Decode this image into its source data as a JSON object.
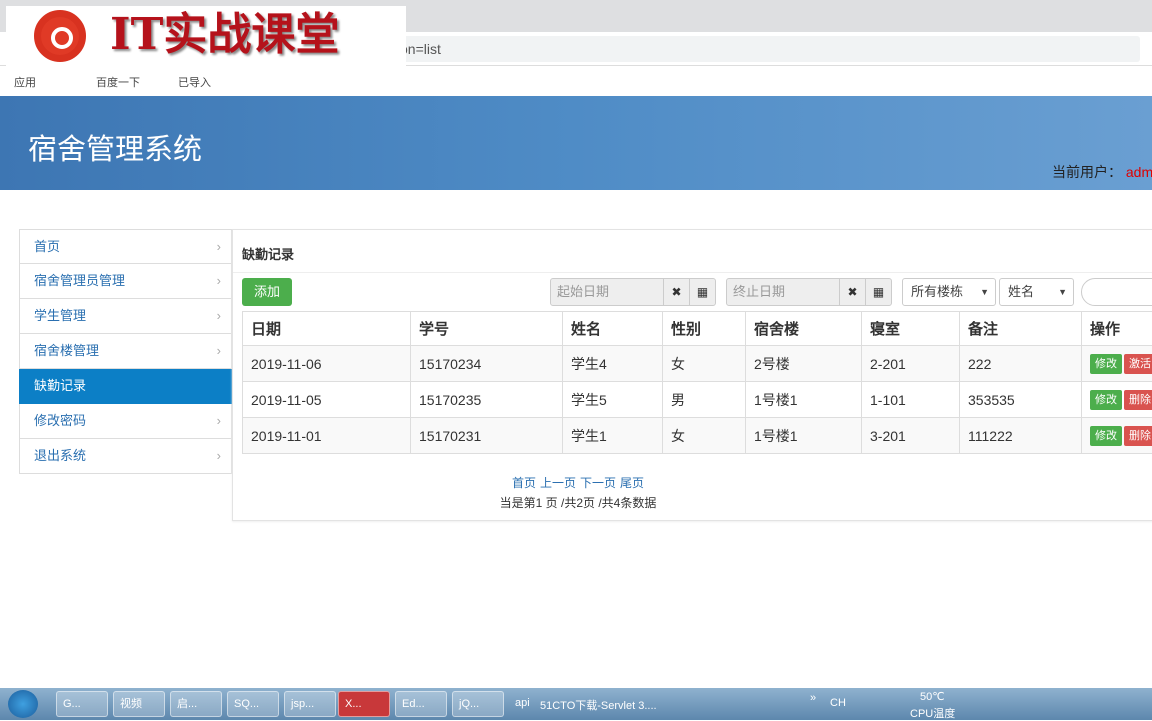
{
  "browser": {
    "address": "on=list",
    "bookmarks": [
      "应用",
      "百度一下",
      "已导入"
    ]
  },
  "watermark": {
    "text": "IT实战课堂"
  },
  "header": {
    "title": "宿舍管理系统",
    "user_label": "当前用户：",
    "user": "admin"
  },
  "sidebar": {
    "items": [
      {
        "label": "首页"
      },
      {
        "label": "宿舍管理员管理"
      },
      {
        "label": "学生管理"
      },
      {
        "label": "宿舍楼管理"
      },
      {
        "label": "缺勤记录",
        "active": true
      },
      {
        "label": "修改密码"
      },
      {
        "label": "退出系统"
      }
    ]
  },
  "main": {
    "title": "缺勤记录",
    "add_label": "添加",
    "start_date_placeholder": "起始日期",
    "end_date_placeholder": "终止日期",
    "building_select": "所有楼栋",
    "field_select": "姓名",
    "columns": [
      "日期",
      "学号",
      "姓名",
      "性别",
      "宿舍楼",
      "寝室",
      "备注",
      "操作"
    ],
    "rows": [
      {
        "date": "2019-11-06",
        "id": "15170234",
        "name": "学生4",
        "gender": "女",
        "building": "2号楼",
        "room": "2-201",
        "note": "222",
        "edit": "修改",
        "action2": "激活"
      },
      {
        "date": "2019-11-05",
        "id": "15170235",
        "name": "学生5",
        "gender": "男",
        "building": "1号楼1",
        "room": "1-101",
        "note": "353535",
        "edit": "修改",
        "action2": "删除"
      },
      {
        "date": "2019-11-01",
        "id": "15170231",
        "name": "学生1",
        "gender": "女",
        "building": "1号楼1",
        "room": "3-201",
        "note": "111222",
        "edit": "修改",
        "action2": "删除"
      }
    ],
    "pagination": {
      "first": "首页",
      "prev": "上一页",
      "next": "下一页",
      "last": "尾页",
      "info": "当是第1 页 /共2页  /共4条数据"
    }
  },
  "taskbar": {
    "items": [
      "G...",
      "视频",
      "启...",
      "SQ...",
      "jsp...",
      "X...",
      "Ed...",
      "jQ..."
    ],
    "api": "api",
    "window": "51CTO下载-Servlet 3....",
    "lang": "CH",
    "temp": "50℃",
    "temp_label": "CPU温度"
  }
}
